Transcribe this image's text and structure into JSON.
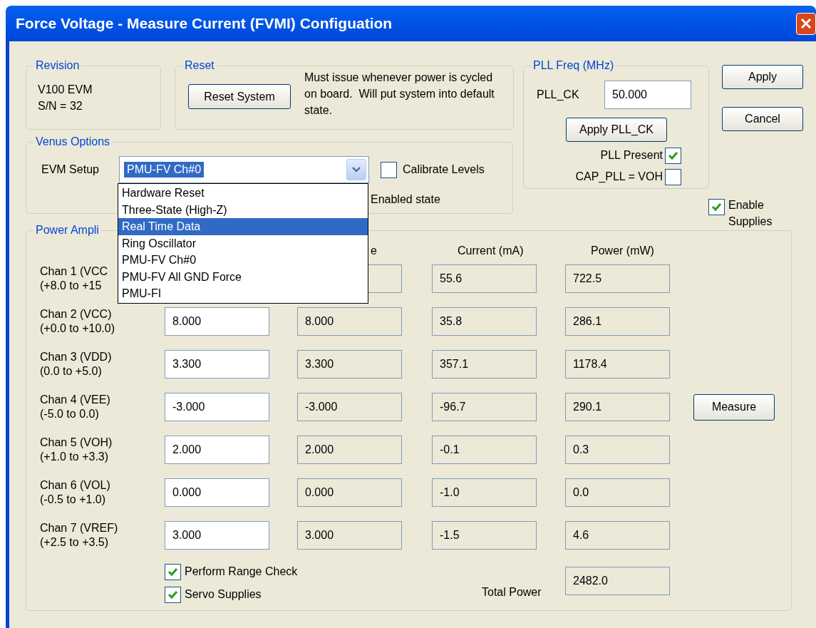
{
  "window": {
    "title": "Force Voltage - Measure Current (FVMI) Configuation"
  },
  "revision": {
    "title": "Revision",
    "lines": [
      "V100 EVM",
      "S/N = 32"
    ]
  },
  "reset": {
    "title": "Reset",
    "button": "Reset System",
    "note": "Must issue whenever power is cycled on board.  Will put system into default state."
  },
  "pll": {
    "title": "PLL Freq (MHz)",
    "label": "PLL_CK",
    "value": "50.000",
    "button": "Apply PLL_CK",
    "checks": [
      {
        "label": "PLL Present",
        "checked": true
      },
      {
        "label": "CAP_PLL = VOH",
        "checked": false
      }
    ]
  },
  "buttons": [
    "Apply",
    "Cancel"
  ],
  "venus": {
    "title": "Venus Options",
    "setup_label": "EVM Setup",
    "setup_value": "PMU-FV Ch#0",
    "calibrate": {
      "label": "Calibrate Levels",
      "checked": false
    },
    "status_text": "Enabled state",
    "dropdown": [
      {
        "label": "Hardware Reset",
        "selected": false
      },
      {
        "label": "Three-State (High-Z)",
        "selected": false
      },
      {
        "label": "Real Time Data",
        "selected": true
      },
      {
        "label": "Ring Oscillator",
        "selected": false
      },
      {
        "label": "PMU-FV Ch#0",
        "selected": false
      },
      {
        "label": "PMU-FV All GND Force",
        "selected": false
      },
      {
        "label": "PMU-FI",
        "selected": false
      }
    ]
  },
  "enable_supplies": {
    "label": "Enable Supplies",
    "checked": true
  },
  "power": {
    "title": "Power Ampli",
    "columns": [
      "e",
      "Current (mA)",
      "Power (mW)"
    ],
    "rows": [
      {
        "name": "Chan 1 (VCC",
        "range": "(+8.0 to +15",
        "current": "55.6",
        "power": "722.5"
      },
      {
        "name": "Chan 2 (VCC)",
        "range": "(+0.0 to +10.0)",
        "set": "8.000",
        "measured": "8.000",
        "current": "35.8",
        "power": "286.1"
      },
      {
        "name": "Chan 3 (VDD)",
        "range": "(0.0 to +5.0)",
        "set": "3.300",
        "measured": "3.300",
        "current": "357.1",
        "power": "1178.4"
      },
      {
        "name": "Chan 4 (VEE)",
        "range": "(-5.0 to 0.0)",
        "set": "-3.000",
        "measured": "-3.000",
        "current": "-96.7",
        "power": "290.1"
      },
      {
        "name": "Chan 5 (VOH)",
        "range": "(+1.0 to +3.3)",
        "set": "2.000",
        "measured": "2.000",
        "current": "-0.1",
        "power": "0.3"
      },
      {
        "name": "Chan 6 (VOL)",
        "range": "(-0.5 to +1.0)",
        "set": "0.000",
        "measured": "0.000",
        "current": "-1.0",
        "power": "0.0"
      },
      {
        "name": "Chan 7 (VREF)",
        "range": "(+2.5 to +3.5)",
        "set": "3.000",
        "measured": "3.000",
        "current": "-1.5",
        "power": "4.6"
      }
    ],
    "measure_button": "Measure",
    "checks": [
      {
        "label": "Perform Range Check",
        "checked": true
      },
      {
        "label": "Servo Supplies",
        "checked": true
      }
    ],
    "total_label": "Total Power",
    "total": "2482.0"
  }
}
